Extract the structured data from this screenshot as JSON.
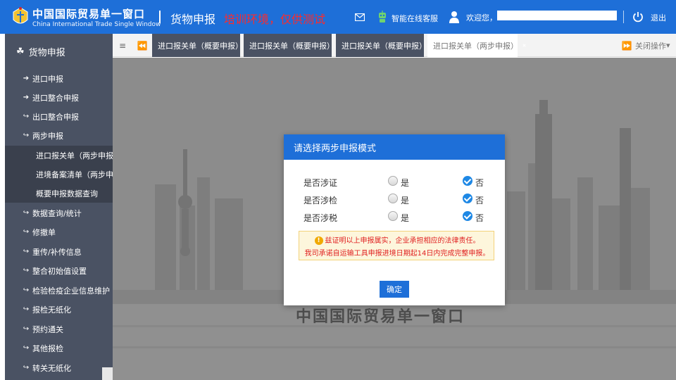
{
  "header": {
    "logo_cn": "中国国际贸易单一窗口",
    "logo_en": "China International Trade Single Window",
    "module_title": "货物申报",
    "env_label": "培训环境，仅供测试",
    "bot_label": "智能在线客服",
    "welcome": "欢迎您，",
    "logout": "退出",
    "icons": [
      "mail-icon",
      "robot-icon",
      "user-icon",
      "power-icon"
    ]
  },
  "sidebar": {
    "title": "货物申报",
    "items": [
      {
        "label": "进口申报",
        "icon": "sign-in-icon"
      },
      {
        "label": "进口整合申报",
        "icon": "sign-in-icon"
      },
      {
        "label": "出口整合申报",
        "icon": "sign-out-icon"
      },
      {
        "label": "两步申报",
        "icon": "sign-out-icon"
      },
      {
        "label": "进口报关单（两步申报）",
        "sub": true
      },
      {
        "label": "进境备案清单（两步申报",
        "sub": true
      },
      {
        "label": "概要申报数据查询",
        "sub": true
      },
      {
        "label": "数据查询/统计",
        "icon": "sign-out-icon"
      },
      {
        "label": "修撤单",
        "icon": "sign-out-icon"
      },
      {
        "label": "重传/补传信息",
        "icon": "sign-out-icon"
      },
      {
        "label": "整合初始值设置",
        "icon": "sign-out-icon"
      },
      {
        "label": "检验检疫企业信息维护",
        "icon": "sign-out-icon"
      },
      {
        "label": "报检无纸化",
        "icon": "sign-out-icon"
      },
      {
        "label": "预约通关",
        "icon": "sign-out-icon"
      },
      {
        "label": "其他报检",
        "icon": "sign-out-icon"
      },
      {
        "label": "转关无纸化",
        "icon": "sign-out-icon"
      }
    ]
  },
  "tabs": [
    {
      "label": "进口报关单（概要申报）",
      "active": false
    },
    {
      "label": "进口报关单（概要申报）",
      "active": false
    },
    {
      "label": "进口报关单（概要申报）",
      "active": false
    },
    {
      "label": "进口报关单（两步申报）",
      "active": true
    }
  ],
  "close_ops": "关闭操作",
  "main_caption": "中国国际贸易单一窗口",
  "modal": {
    "title": "请选择两步申报模式",
    "yes_label": "是",
    "no_label": "否",
    "questions": [
      {
        "label": "是否涉证",
        "selected": "否"
      },
      {
        "label": "是否涉检",
        "selected": "否"
      },
      {
        "label": "是否涉税",
        "selected": "否"
      }
    ],
    "notice_line1": "兹证明以上申报属实，企业承担相应的法律责任。",
    "notice_line2": "我司承诺自运输工具申报进境日期起14日内完成完整申报。",
    "confirm_label": "确定"
  },
  "colors": {
    "header_bg": "#1e6fd8",
    "sidebar_bg": "#4a5263",
    "env_label": "#ff2a2a",
    "checked_radio": "#1e88e5",
    "notice_text": "#e02020"
  }
}
